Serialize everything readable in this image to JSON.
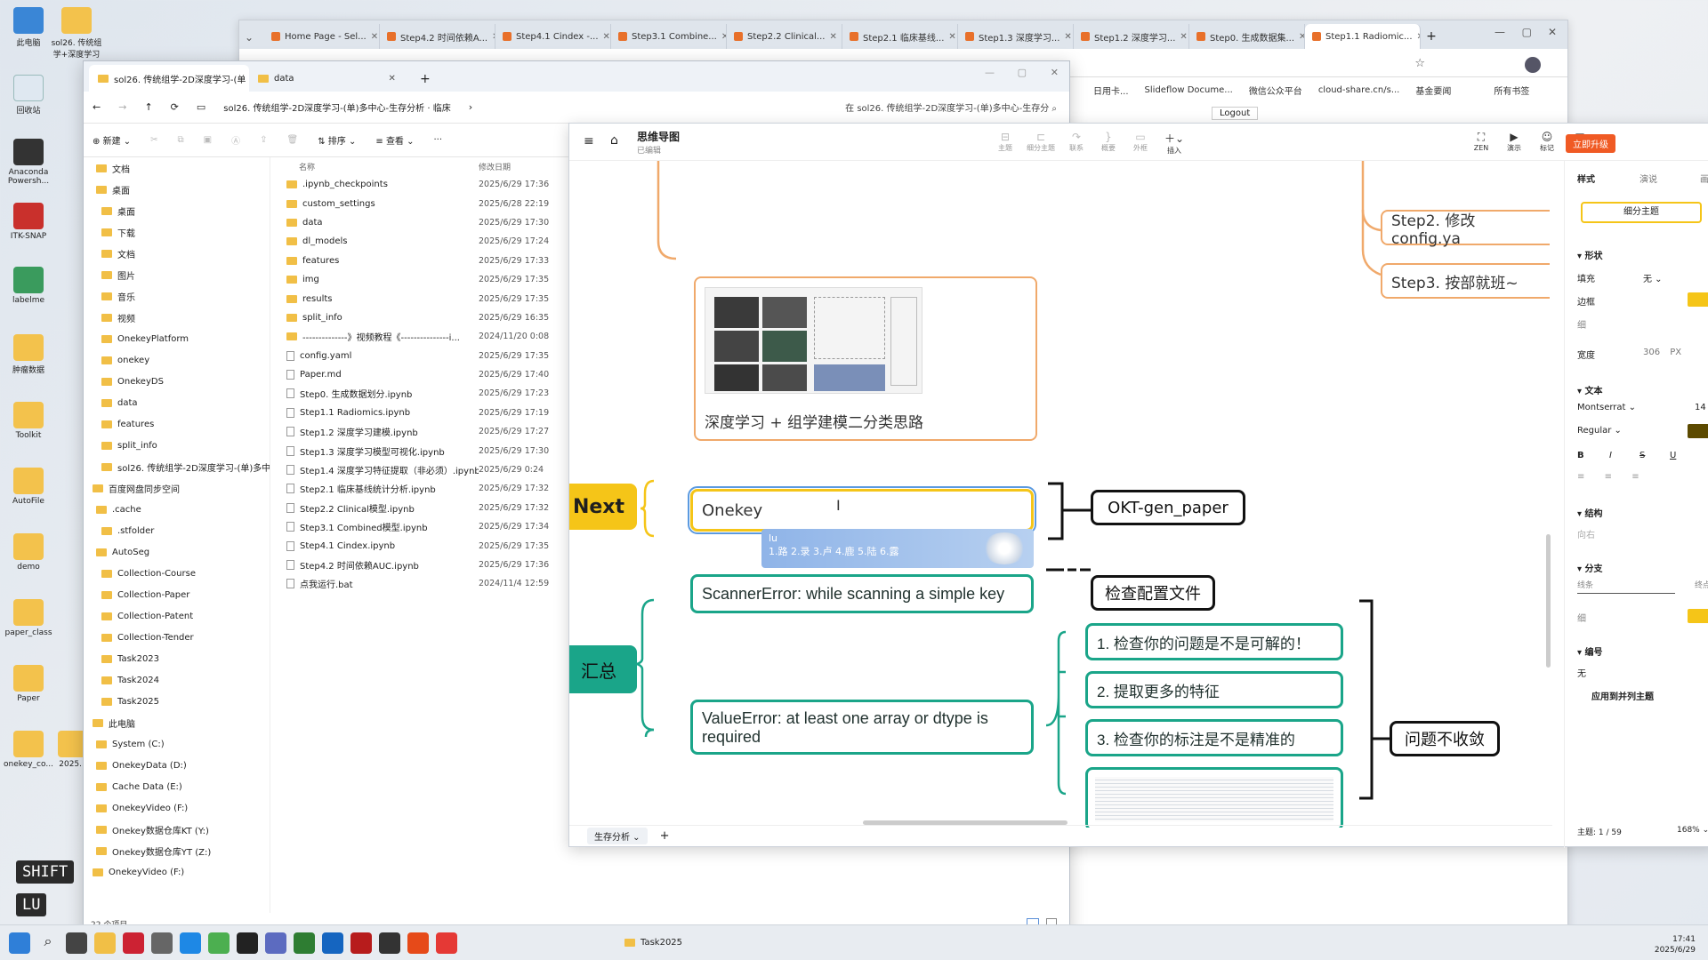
{
  "desktop_icons": [
    {
      "label": "此电脑"
    },
    {
      "label": "sol26. 传统组学+深度学习"
    },
    {
      "label": "回收站"
    },
    {
      "label": "Anaconda Powersh..."
    },
    {
      "label": "ITK-SNAP"
    },
    {
      "label": "labelme"
    },
    {
      "label": "肿瘤数据"
    },
    {
      "label": "Toolkit"
    },
    {
      "label": "AutoFile"
    },
    {
      "label": "demo"
    },
    {
      "label": "paper_class"
    },
    {
      "label": "Paper"
    },
    {
      "label": "onekey_co..."
    },
    {
      "label": "2025..."
    }
  ],
  "key_overlay": {
    "shift": "SHIFT",
    "lu": "LU"
  },
  "browser": {
    "tabs": [
      {
        "label": "Home Page - Sel..."
      },
      {
        "label": "Step4.2 时间依赖A..."
      },
      {
        "label": "Step4.1 Cindex -..."
      },
      {
        "label": "Step3.1 Combine..."
      },
      {
        "label": "Step2.2 Clinical..."
      },
      {
        "label": "Step2.1 临床基线..."
      },
      {
        "label": "Step1.3 深度学习..."
      },
      {
        "label": "Step1.2 深度学习..."
      },
      {
        "label": "Step0. 生成数据集..."
      },
      {
        "label": "Step1.1 Radiomic..."
      }
    ],
    "bookmarks": [
      "日用卡...",
      "Slideflow Docume...",
      "微信公众平台",
      "cloud-share.cn/s...",
      "基金要闻",
      "所有书签"
    ],
    "logout": "Logout"
  },
  "explorer": {
    "tabs": [
      {
        "label": "sol26. 传统组学-2D深度学习-(单"
      },
      {
        "label": "data"
      }
    ],
    "address": "sol26. 传统组学-2D深度学习-(单)多中心-生存分析 · 临床",
    "search_placeholder": "在 sol26. 传统组学-2D深度学习-(单)多中心-生存分",
    "toolbar": {
      "new": "新建",
      "sort": "排序",
      "view": "查看",
      "more": "···"
    },
    "sidebar": [
      "文档",
      "桌面",
      "桌面",
      "下载",
      "文档",
      "图片",
      "音乐",
      "视频",
      "OnekeyPlatform",
      "onekey",
      "OnekeyDS",
      "data",
      "features",
      "split_info",
      "sol26. 传统组学-2D深度学习-(单)多中心-生",
      "百度网盘同步空间",
      ".cache",
      ".stfolder",
      "AutoSeg",
      "Collection-Course",
      "Collection-Paper",
      "Collection-Patent",
      "Collection-Tender",
      "Task2023",
      "Task2024",
      "Task2025",
      "此电脑",
      "System (C:)",
      "OnekeyData (D:)",
      "Cache Data (E:)",
      "OnekeyVideo (F:)",
      "Onekey数据仓库KT (Y:)",
      "Onekey数据仓库YT (Z:)",
      "OnekeyVideo (F:)"
    ],
    "columns": {
      "name": "名称",
      "date": "修改日期"
    },
    "files": [
      {
        "name": ".ipynb_checkpoints",
        "date": "2025/6/29 17:36",
        "kind": "folder"
      },
      {
        "name": "custom_settings",
        "date": "2025/6/28 22:19",
        "kind": "folder"
      },
      {
        "name": "data",
        "date": "2025/6/29 17:30",
        "kind": "folder"
      },
      {
        "name": "dl_models",
        "date": "2025/6/29 17:24",
        "kind": "folder"
      },
      {
        "name": "features",
        "date": "2025/6/29 17:33",
        "kind": "folder"
      },
      {
        "name": "img",
        "date": "2025/6/29 17:35",
        "kind": "folder"
      },
      {
        "name": "results",
        "date": "2025/6/29 17:35",
        "kind": "folder"
      },
      {
        "name": "split_info",
        "date": "2025/6/29 16:35",
        "kind": "folder"
      },
      {
        "name": "--------------》视频教程《---------------i...",
        "date": "2024/11/20 0:08",
        "kind": "folder"
      },
      {
        "name": "config.yaml",
        "date": "2025/6/29 17:35",
        "kind": "file"
      },
      {
        "name": "Paper.md",
        "date": "2025/6/29 17:40",
        "kind": "file"
      },
      {
        "name": "Step0. 生成数据划分.ipynb",
        "date": "2025/6/29 17:23",
        "kind": "file"
      },
      {
        "name": "Step1.1 Radiomics.ipynb",
        "date": "2025/6/29 17:19",
        "kind": "file"
      },
      {
        "name": "Step1.2 深度学习建模.ipynb",
        "date": "2025/6/29 17:27",
        "kind": "file"
      },
      {
        "name": "Step1.3 深度学习模型可视化.ipynb",
        "date": "2025/6/29 17:30",
        "kind": "file"
      },
      {
        "name": "Step1.4 深度学习特征提取（非必须）.ipynb",
        "date": "2025/6/29 0:24",
        "kind": "file"
      },
      {
        "name": "Step2.1 临床基线统计分析.ipynb",
        "date": "2025/6/29 17:32",
        "kind": "file"
      },
      {
        "name": "Step2.2 Clinical模型.ipynb",
        "date": "2025/6/29 17:32",
        "kind": "file"
      },
      {
        "name": "Step3.1 Combined模型.ipynb",
        "date": "2025/6/29 17:34",
        "kind": "file"
      },
      {
        "name": "Step4.1 Cindex.ipynb",
        "date": "2025/6/29 17:35",
        "kind": "file"
      },
      {
        "name": "Step4.2 时间依赖AUC.ipynb",
        "date": "2025/6/29 17:36",
        "kind": "file"
      },
      {
        "name": "点我运行.bat",
        "date": "2024/11/4 12:59",
        "kind": "file"
      }
    ],
    "status": "22 个项目"
  },
  "mindmap": {
    "title": "思维导图",
    "subtitle": "已编辑",
    "tools": [
      "主题",
      "细分主题",
      "联系",
      "概要",
      "外框",
      "插入",
      "ZEN",
      "演示",
      "标记",
      "样式"
    ],
    "upgrade": "立即升级",
    "nodes": {
      "step2": "Step2. 修改config.ya",
      "step3": "Step3. 按部就班~",
      "image_caption": "深度学习 + 组学建模二分类思路",
      "next": "Next",
      "onekey": "Onekey",
      "okt": "OKT-gen_paper",
      "scanner_error": "ScannerError: while scanning a simple key",
      "check_config": "检查配置文件",
      "summary": "汇总",
      "tip1": "1. 检查你的问题是不是可解的！",
      "tip2": "2. 提取更多的特征",
      "tip3": "3. 检查你的标注是不是精准的",
      "value_error": "ValueError: at least one array or dtype is required",
      "not_converge": "问题不收敛"
    },
    "ime": {
      "input": "lu",
      "candidates": "1.路 2.录 3.卢 4.鹿 5.陆 6.露"
    },
    "sheet_tab": "生存分析",
    "panel": {
      "tabs": [
        "样式",
        "演说",
        "画布"
      ],
      "subtopic_button": "细分主题",
      "shape": "形状",
      "fill": "填充",
      "fill_value": "无",
      "border": "边框",
      "thin": "细",
      "width": "宽度",
      "width_value": "306",
      "width_unit": "PX",
      "text": "文本",
      "font": "Montserrat",
      "font_size": "14",
      "weight": "Regular",
      "structure": "结构",
      "structure_value": "向右",
      "branch": "分支",
      "line": "线条",
      "end": "终点",
      "number": "编号",
      "number_value": "无",
      "apply_siblings": "应用到并列主题"
    },
    "footer": {
      "topics": "主题: 1 / 59",
      "zoom": "168%"
    },
    "colors": {
      "teal": "#1aa589",
      "yellow": "#f5c518",
      "orange": "#f0a96b",
      "upgrade": "#f05a24"
    }
  },
  "taskbar": {
    "time": "17:41",
    "date": "2025/6/29",
    "folder_item": "Task2025"
  }
}
